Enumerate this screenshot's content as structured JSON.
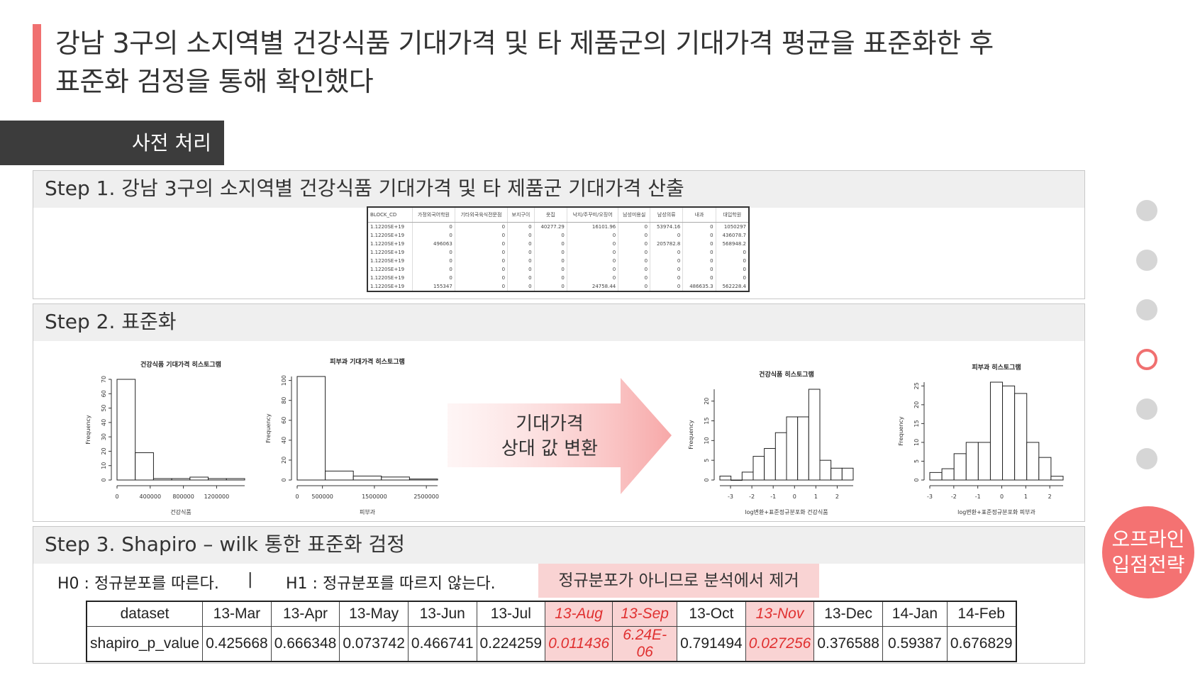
{
  "title": {
    "line1": "강남 3구의 소지역별 건강식품 기대가격 및 타 제품군의 기대가격 평균을 표준화한 후",
    "line2": "표준화 검정을 통해 확인했다"
  },
  "section_tag": "사전 처리",
  "steps": {
    "step1": "Step 1. 강남 3구의 소지역별 건강식품 기대가격 및 타 제품군 기대가격 산출",
    "step2": "Step 2. 표준화",
    "step3": "Step 3. Shapiro – wilk 통한 표준화 검정"
  },
  "mini_table": {
    "headers": [
      "BLOCK_CD",
      "가정외국어학원",
      "기타외국육식전문점",
      "보지구이",
      "옷집",
      "낙지/주꾸미/오징어",
      "남성미용실",
      "남성의류",
      "내과",
      "대입학원"
    ],
    "rows": [
      [
        "1.1220SE+19",
        "0",
        "0",
        "0",
        "40277.29",
        "16101.96",
        "0",
        "53974.16",
        "0",
        "1050297"
      ],
      [
        "1.1220SE+19",
        "0",
        "0",
        "0",
        "0",
        "0",
        "0",
        "0",
        "0",
        "436078.7"
      ],
      [
        "1.1220SE+19",
        "496063",
        "0",
        "0",
        "0",
        "0",
        "0",
        "205782.8",
        "0",
        "568948.2"
      ],
      [
        "1.1220SE+19",
        "0",
        "0",
        "0",
        "0",
        "0",
        "0",
        "0",
        "0",
        "0"
      ],
      [
        "1.1220SE+19",
        "0",
        "0",
        "0",
        "0",
        "0",
        "0",
        "0",
        "0",
        "0"
      ],
      [
        "1.1220SE+19",
        "0",
        "0",
        "0",
        "0",
        "0",
        "0",
        "0",
        "0",
        "0"
      ],
      [
        "1.1220SE+19",
        "0",
        "0",
        "0",
        "0",
        "0",
        "0",
        "0",
        "0",
        "0"
      ],
      [
        "1.1220SE+19",
        "155347",
        "0",
        "0",
        "0",
        "24758.44",
        "0",
        "0",
        "486635.3",
        "562228.4"
      ]
    ]
  },
  "histograms": {
    "h1": {
      "title": "건강식품 기대가격 히스토그램",
      "xlabel": "건강식품",
      "ylabel": "Frequency",
      "xticks": [
        "0",
        "400000",
        "800000",
        "1200000"
      ],
      "yticks": [
        "0",
        "10",
        "20",
        "30",
        "40",
        "50",
        "60",
        "70"
      ],
      "values": [
        70,
        19,
        1,
        1,
        2,
        1,
        1
      ]
    },
    "h2": {
      "title": "피부과 기대가격 히스토그램",
      "xlabel": "피부과",
      "ylabel": "Frequency",
      "xticks": [
        "0",
        "500000",
        "1500000",
        "2500000"
      ],
      "yticks": [
        "0",
        "20",
        "40",
        "60",
        "80",
        "100"
      ],
      "values": [
        104,
        9,
        4,
        3,
        1
      ]
    },
    "h3": {
      "title": "건강식품 히스토그램",
      "xlabel": "log변환+표준정규분포화 건강식품",
      "ylabel": "Frequency",
      "xticks": [
        "-3",
        "-2",
        "-1",
        "0",
        "1",
        "2"
      ],
      "yticks": [
        "0",
        "5",
        "10",
        "15",
        "20"
      ],
      "values": [
        1,
        0,
        2,
        6,
        8,
        12,
        16,
        16,
        23,
        5,
        3,
        3
      ]
    },
    "h4": {
      "title": "피부과 히스토그램",
      "xlabel": "log변환+표준정규분포화 피부과",
      "ylabel": "Frequency",
      "xticks": [
        "-3",
        "-2",
        "-1",
        "0",
        "1",
        "2"
      ],
      "yticks": [
        "0",
        "5",
        "10",
        "15",
        "20",
        "25"
      ],
      "values": [
        2,
        3,
        7,
        10,
        10,
        26,
        25,
        23,
        10,
        6,
        1
      ]
    }
  },
  "arrow": {
    "line1": "기대가격",
    "line2": "상대 값 변환"
  },
  "hypotheses": {
    "h0": "H0 : 정규분포를 따른다.",
    "sep": "|",
    "h1": "H1 : 정규분포를 따르지 않는다."
  },
  "note": "정규분포가 아니므로 분석에서 제거",
  "result_table": {
    "row1_label": "dataset",
    "row2_label": "shapiro_p_value",
    "columns": [
      {
        "name": "13-Mar",
        "p": "0.425668",
        "highlight": false
      },
      {
        "name": "13-Apr",
        "p": "0.666348",
        "highlight": false
      },
      {
        "name": "13-May",
        "p": "0.073742",
        "highlight": false
      },
      {
        "name": "13-Jun",
        "p": "0.466741",
        "highlight": false
      },
      {
        "name": "13-Jul",
        "p": "0.224259",
        "highlight": false
      },
      {
        "name": "13-Aug",
        "p": "0.011436",
        "highlight": true
      },
      {
        "name": "13-Sep",
        "p": "6.24E-06",
        "highlight": true
      },
      {
        "name": "13-Oct",
        "p": "0.791494",
        "highlight": false
      },
      {
        "name": "13-Nov",
        "p": "0.027256",
        "highlight": true
      },
      {
        "name": "13-Dec",
        "p": "0.376588",
        "highlight": false
      },
      {
        "name": "14-Jan",
        "p": "0.59387",
        "highlight": false
      },
      {
        "name": "14-Feb",
        "p": "0.676829",
        "highlight": false
      }
    ]
  },
  "nav": {
    "active_index": 3,
    "count": 6
  },
  "badge": {
    "line1": "오프라인",
    "line2": "입점전략"
  },
  "colors": {
    "accent": "#f07070",
    "highlight_bg": "#f9d3d3",
    "highlight_text": "#e03030"
  }
}
